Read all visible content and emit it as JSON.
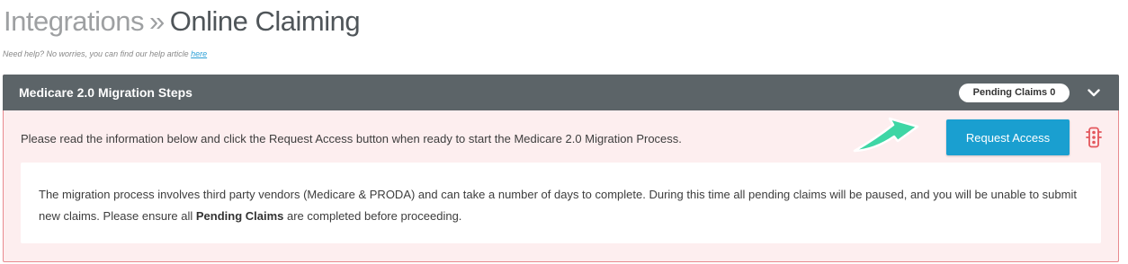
{
  "header": {
    "crumb_parent": "Integrations",
    "crumb_separator": "»",
    "crumb_current": "Online Claiming"
  },
  "help": {
    "prefix": "Need help? No worries, you can find our help article ",
    "link_label": "here"
  },
  "panel": {
    "title": "Medicare 2.0 Migration Steps",
    "pending_label": "Pending Claims 0",
    "intro": "Please read the information below and click the Request Access button when ready to start the Medicare 2.0 Migration Process.",
    "request_button_label": "Request Access",
    "info_part1": "The migration process involves third party vendors (Medicare & PRODA) and can take a number of days to complete. During this time all pending claims will be paused, and you will be unable to submit new claims. Please ensure all ",
    "info_bold": "Pending Claims",
    "info_part2": " are completed before proceeding."
  },
  "colors": {
    "header_bg": "#5c6468",
    "panel_bg": "#fdeeef",
    "panel_border": "#e98a8f",
    "button_bg": "#1a9fd0",
    "arrow": "#3ed6a5",
    "traffic_icon": "#e3565c"
  },
  "icons": {
    "collapse": "chevron-down-icon",
    "status": "traffic-light-icon",
    "pointer": "arrow-icon"
  }
}
